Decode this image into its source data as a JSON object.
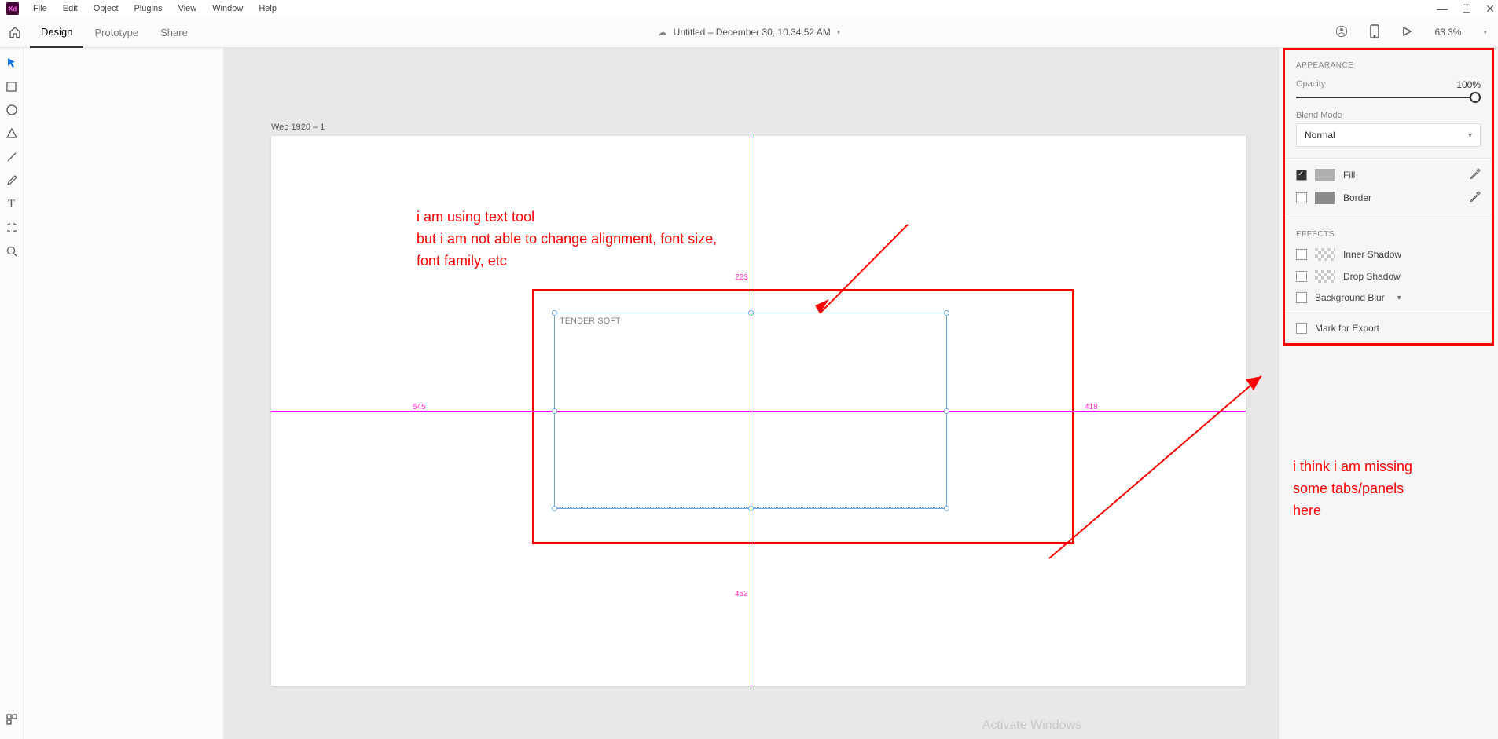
{
  "menu": {
    "file": "File",
    "edit": "Edit",
    "object": "Object",
    "plugins": "Plugins",
    "view": "View",
    "window": "Window",
    "help": "Help",
    "xd": "Xd"
  },
  "window_controls": {
    "min": "—",
    "max": "☐",
    "close": "✕"
  },
  "modes": {
    "design": "Design",
    "prototype": "Prototype",
    "share": "Share"
  },
  "document": {
    "title": "Untitled – December 30, 10.34.52 AM"
  },
  "zoom": "63.3%",
  "artboard": {
    "label": "Web 1920 – 1"
  },
  "textbox_content": "TENDER SOFT",
  "measurements": {
    "top": "223",
    "left": "545",
    "right": "418",
    "bottom": "452"
  },
  "annotations": {
    "a1_l1": "i am using text tool",
    "a1_l2": "but i am not able to change alignment, font size,",
    "a1_l3": "font family, etc",
    "a2_l1": "i think i am missing",
    "a2_l2": "some tabs/panels",
    "a2_l3": "here"
  },
  "panel": {
    "appearance_h": "APPEARANCE",
    "opacity_lbl": "Opacity",
    "opacity_val": "100%",
    "blend_lbl": "Blend Mode",
    "blend_val": "Normal",
    "fill": "Fill",
    "border": "Border",
    "effects_h": "EFFECTS",
    "inner_shadow": "Inner Shadow",
    "drop_shadow": "Drop Shadow",
    "bg_blur": "Background Blur",
    "mark_export": "Mark for Export"
  },
  "watermark": "Activate Windows"
}
